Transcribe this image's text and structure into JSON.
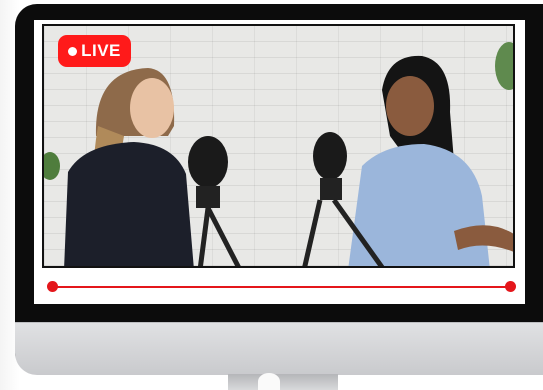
{
  "live_badge": {
    "label": "LIVE"
  },
  "player": {
    "progress": 1.0,
    "accent_color": "#e4161b",
    "badge_color": "#ff1a1a"
  },
  "icons": [
    "live-dot-icon",
    "apple-logo-icon"
  ]
}
